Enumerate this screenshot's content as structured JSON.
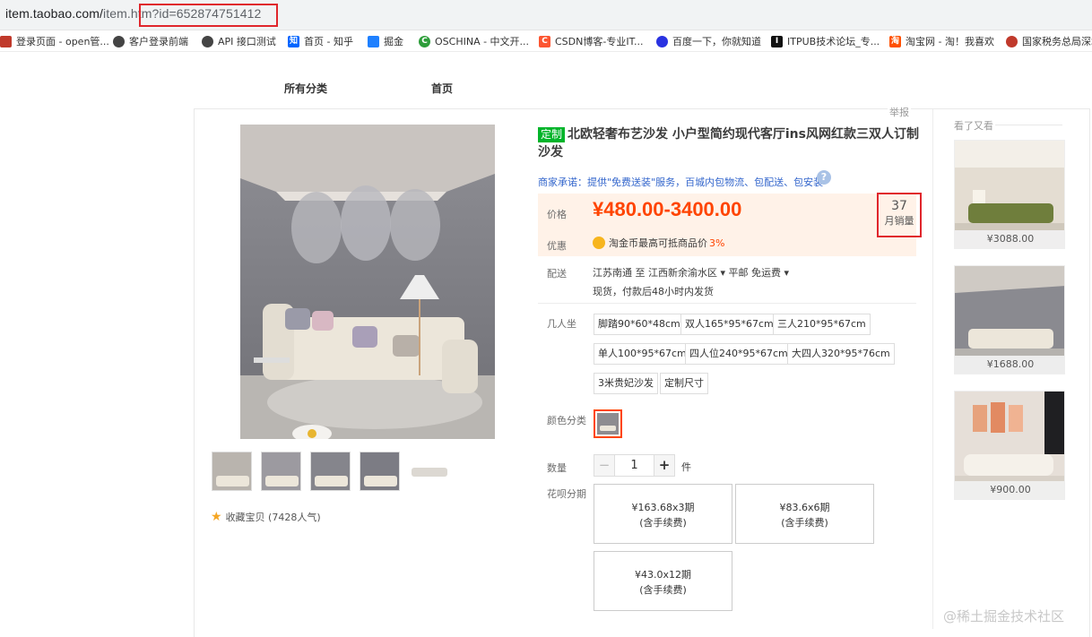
{
  "browser": {
    "url_host": "item.taobao.com/",
    "url_path": "item.htm",
    "url_query": "?id=652874751412"
  },
  "bookmarks": [
    {
      "label": "登录页面 - open管...",
      "icon": "globe-icon",
      "color": "#c0392b"
    },
    {
      "label": "客户登录前端",
      "icon": "globe-icon",
      "color": "#444444"
    },
    {
      "label": "API 接口测试",
      "icon": "globe-icon",
      "color": "#444444"
    },
    {
      "label": "首页 - 知乎",
      "icon": "zhihu-icon",
      "color": "#0066ff"
    },
    {
      "label": "掘金",
      "icon": "juejin-icon",
      "color": "#1e80ff"
    },
    {
      "label": "OSCHINA - 中文开...",
      "icon": "oschina-icon",
      "color": "#2d9d3a"
    },
    {
      "label": "CSDN博客-专业IT...",
      "icon": "csdn-icon",
      "color": "#fc5531"
    },
    {
      "label": "百度一下，你就知道",
      "icon": "baidu-icon",
      "color": "#2932e1"
    },
    {
      "label": "ITPUB技术论坛_专...",
      "icon": "itpub-icon",
      "color": "#111111"
    },
    {
      "label": "淘宝网 - 淘！我喜欢",
      "icon": "taobao-icon",
      "color": "#ff5000"
    },
    {
      "label": "国家税务总局深圳",
      "icon": "tax-icon",
      "color": "#c0392b"
    }
  ],
  "topnav": {
    "categories": "所有分类",
    "home": "首页"
  },
  "report": "举报",
  "product": {
    "tag": "定制",
    "title": "北欧轻奢布艺沙发 小户型简约现代客厅ins风网红款三双人订制沙发",
    "promise": "商家承诺：提供\"免费送装\"服务，百城内包物流、包配送、包安装",
    "price_label": "价格",
    "price": "¥480.00-3400.00",
    "sales_num": "37",
    "sales_label": "月销量",
    "discount_label": "优惠",
    "discount_text": "淘金币最高可抵商品价",
    "discount_pct": "3%",
    "ship_label": "配送",
    "ship_from": "江苏南通 至  江西新余渝水区 ▾   平邮 免运费 ▾",
    "ship_note": "现货，付款后48小时内发货",
    "seats_label": "几人坐",
    "seats": [
      "脚踏90*60*48cm",
      "双人165*95*67cm",
      "三人210*95*67cm",
      "单人100*95*67cm",
      "四人位240*95*67cm",
      "大四人320*95*76cm",
      "3米贵妃沙发",
      "定制尺寸"
    ],
    "color_label": "颜色分类",
    "qty_label": "数量",
    "qty": "1",
    "qty_minus": "−",
    "qty_plus": "+",
    "qty_unit": "件",
    "huabei_label": "花呗分期",
    "huabei": [
      {
        "amount": "¥163.68x3期",
        "fee": "(含手续费)"
      },
      {
        "amount": "¥83.6x6期",
        "fee": "(含手续费)"
      },
      {
        "amount": "¥43.0x12期",
        "fee": "(含手续费)"
      }
    ],
    "favorite": "收藏宝贝 (7428人气)"
  },
  "sidebar": {
    "title": "看了又看",
    "items": [
      {
        "price": "¥3088.00"
      },
      {
        "price": "¥1688.00"
      },
      {
        "price": "¥900.00"
      }
    ]
  },
  "watermark": "@稀土掘金技术社区"
}
